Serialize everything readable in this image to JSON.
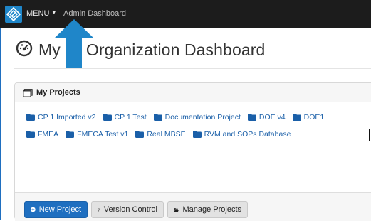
{
  "navbar": {
    "logo_icon": "diamond-logo-icon",
    "menu_label": "MENU",
    "menu_caret_icon": "caret-down-icon",
    "admin_link_label": "Admin Dashboard"
  },
  "page": {
    "title_icon": "dashboard-gauge-icon",
    "title_prefix": "My",
    "title_suffix": "Organization Dashboard"
  },
  "overlay": {
    "arrow_icon": "arrow-up-icon",
    "arrow_color": "#1f86c9"
  },
  "projects_panel": {
    "title": "My Projects",
    "header_icon": "window-icon",
    "folder_icon": "folder-icon",
    "rows": [
      [
        "CP 1 Imported v2",
        "CP 1 Test",
        "Documentation Project",
        "DOE v4",
        "DOE1"
      ],
      [
        "FMEA",
        "FMECA Test v1",
        "Real MBSE",
        "RVM and SOPs Database"
      ]
    ]
  },
  "footer": {
    "new_project_label": "New Project",
    "new_project_icon": "plus-circle-icon",
    "version_control_label": "Version Control",
    "version_control_icon": "code-branch-icon",
    "manage_projects_label": "Manage Projects",
    "manage_projects_icon": "folder-open-icon"
  },
  "colors": {
    "navbar_bg": "#1c1c1c",
    "accent": "#1f6fc0",
    "link": "#1a5fa8"
  }
}
